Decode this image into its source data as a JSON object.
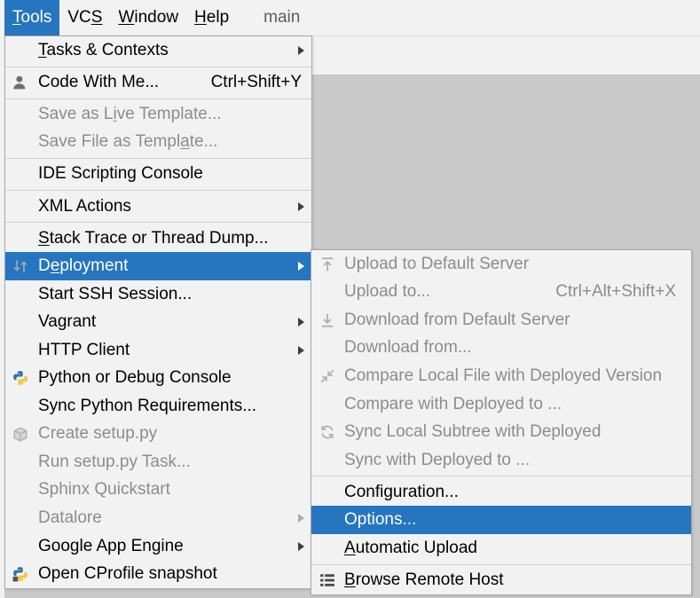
{
  "colors": {
    "highlight": "#2675bf",
    "menu_bg": "#f2f2f2",
    "disabled_text": "#8c8c8c"
  },
  "menubar": {
    "items": [
      {
        "label": "Tools",
        "mnemonic_index": 0,
        "active": true
      },
      {
        "label": "VCS",
        "mnemonic_index": 2,
        "active": false
      },
      {
        "label": "Window",
        "mnemonic_index": 0,
        "active": false
      },
      {
        "label": "Help",
        "mnemonic_index": 0,
        "active": false
      }
    ],
    "title": "main"
  },
  "tools_menu": {
    "items": [
      {
        "label": "Tasks & Contexts",
        "mnemonic_index": 0,
        "submenu": true
      },
      {
        "type": "separator"
      },
      {
        "label": "Code With Me...",
        "icon": "person-icon",
        "shortcut": "Ctrl+Shift+Y"
      },
      {
        "type": "separator"
      },
      {
        "label": "Save as Live Template...",
        "mnemonic_index": 9,
        "disabled": true
      },
      {
        "label": "Save File as Template...",
        "mnemonic_index": 18,
        "disabled": true
      },
      {
        "type": "separator"
      },
      {
        "label": "IDE Scripting Console"
      },
      {
        "type": "separator"
      },
      {
        "label": "XML Actions",
        "submenu": true
      },
      {
        "type": "separator"
      },
      {
        "label": "Stack Trace or Thread Dump...",
        "mnemonic_index": 0
      },
      {
        "label": "Deployment",
        "mnemonic_index": 1,
        "icon": "deployment-icon",
        "submenu": true,
        "highlighted": true
      },
      {
        "label": "Start SSH Session..."
      },
      {
        "label": "Vagrant",
        "submenu": true
      },
      {
        "label": "HTTP Client",
        "submenu": true
      },
      {
        "label": "Python or Debug Console",
        "icon": "python-icon"
      },
      {
        "label": "Sync Python Requirements..."
      },
      {
        "label": "Create setup.py",
        "icon": "setup-py-icon",
        "disabled": true
      },
      {
        "label": "Run setup.py Task...",
        "disabled": true
      },
      {
        "label": "Sphinx Quickstart",
        "disabled": true
      },
      {
        "label": "Datalore",
        "submenu": true,
        "disabled": true
      },
      {
        "label": "Google App Engine",
        "submenu": true
      },
      {
        "label": "Open CProfile snapshot",
        "icon": "cprofile-icon"
      }
    ]
  },
  "deployment_submenu": {
    "items": [
      {
        "label": "Upload to Default Server",
        "icon": "upload-icon",
        "disabled": true
      },
      {
        "label": "Upload to...",
        "shortcut": "Ctrl+Alt+Shift+X",
        "disabled": true
      },
      {
        "label": "Download from Default Server",
        "icon": "download-icon",
        "disabled": true
      },
      {
        "label": "Download from...",
        "disabled": true
      },
      {
        "label": "Compare Local File with Deployed Version",
        "icon": "compare-icon",
        "disabled": true
      },
      {
        "label": "Compare with Deployed to ...",
        "disabled": true
      },
      {
        "label": "Sync Local Subtree with Deployed",
        "icon": "sync-icon",
        "disabled": true
      },
      {
        "label": "Sync with Deployed to ...",
        "disabled": true
      },
      {
        "type": "separator"
      },
      {
        "label": "Configuration..."
      },
      {
        "label": "Options...",
        "highlighted": true
      },
      {
        "label": "Automatic Upload",
        "mnemonic_index": 0
      },
      {
        "type": "separator"
      },
      {
        "label": "Browse Remote Host",
        "mnemonic_index": 0,
        "icon": "browse-icon"
      }
    ]
  }
}
